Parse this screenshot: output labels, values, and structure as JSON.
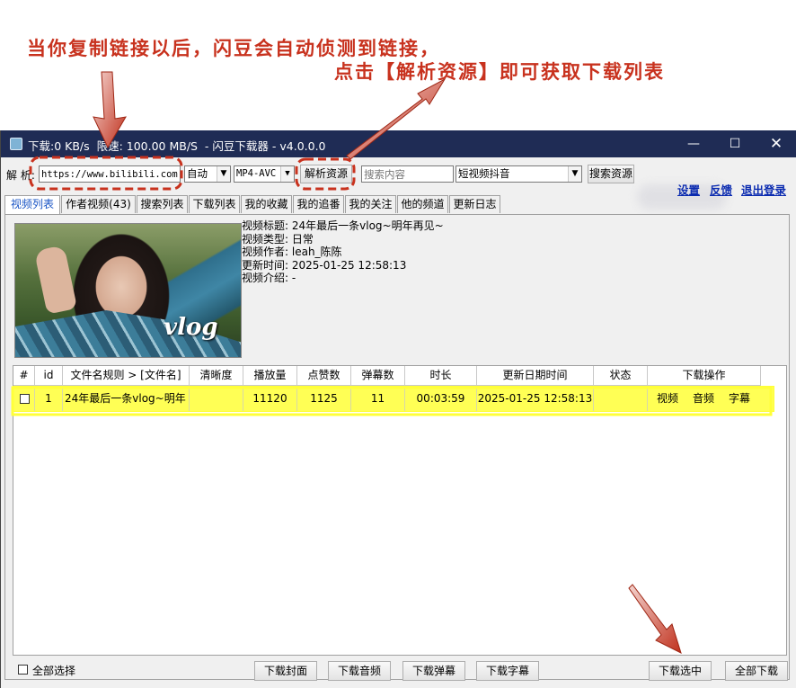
{
  "annotations": {
    "line1": "当你复制链接以后，闪豆会自动侦测到链接，",
    "line2": "点击【解析资源】即可获取下载列表"
  },
  "titlebar": {
    "text": "下载:0 KB/s  限速: 100.00 MB/S  - 闪豆下载器 - v4.0.0.0",
    "minimize": "—",
    "maximize": "☐",
    "close": "✕"
  },
  "toolbar": {
    "parse_label": "解 析:",
    "url_value": "https://www.bilibili.com/video",
    "quality": "自动",
    "codec": "MP4-AVC",
    "parse_button": "解析资源",
    "search_placeholder": "搜索内容",
    "platform": "短视频抖音",
    "search_button": "搜索资源",
    "links": [
      "设置",
      "反馈",
      "退出登录"
    ]
  },
  "tabs": [
    "视频列表",
    "作者视频(43)",
    "搜索列表",
    "下载列表",
    "我的收藏",
    "我的追番",
    "我的关注",
    "他的频道",
    "更新日志"
  ],
  "video_info": {
    "title_label": "视频标题:",
    "title_value": "24年最后一条vlog~明年再见~",
    "type_label": "视频类型:",
    "type_value": "日常",
    "author_label": "视频作者:",
    "author_value": "leah_陈陈",
    "update_label": "更新时间:",
    "update_value": "2025-01-25 12:58:13",
    "intro_label": "视频介绍:",
    "intro_value": "-",
    "thumbnail_text": "vlog"
  },
  "table": {
    "columns": [
      "#",
      "id",
      "文件名规则  >  [文件名]",
      "清晰度",
      "播放量",
      "点赞数",
      "弹幕数",
      "时长",
      "更新日期时间",
      "状态",
      "下载操作"
    ],
    "rows": [
      {
        "id": "1",
        "filename": "24年最后一条vlog~明年",
        "quality": "",
        "plays": "11120",
        "likes": "1125",
        "danmaku": "11",
        "duration": "00:03:59",
        "updated": "2025-01-25 12:58:13",
        "status": "",
        "actions": [
          "视频",
          "音频",
          "字幕"
        ]
      }
    ]
  },
  "bottom": {
    "select_all": "全部选择",
    "buttons": [
      "下载封面",
      "下载音频",
      "下载弹幕",
      "下载字幕"
    ],
    "download_selected": "下载选中",
    "download_all": "全部下载"
  }
}
